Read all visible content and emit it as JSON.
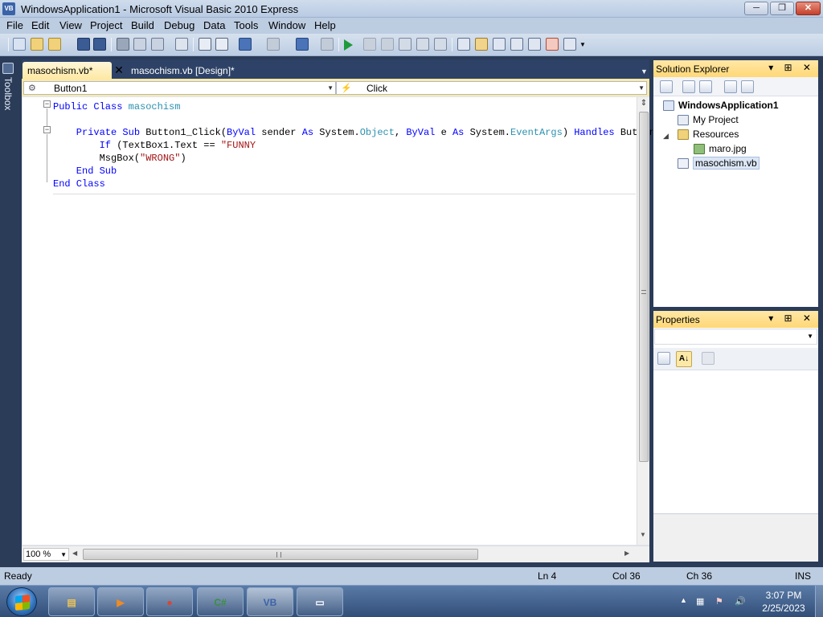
{
  "window": {
    "title": "WindowsApplication1 - Microsoft Visual Basic 2010 Express",
    "app_icon_text": "VB",
    "minimize_glyph": "─",
    "maximize_glyph": "❐",
    "close_glyph": "✕"
  },
  "menu": [
    "File",
    "Edit",
    "View",
    "Project",
    "Build",
    "Debug",
    "Data",
    "Tools",
    "Window",
    "Help"
  ],
  "toolbox_label": "Toolbox",
  "tabs": {
    "active_label": "masochism.vb*",
    "close_glyph": "✕",
    "design_label": "masochism.vb [Design]*",
    "dropdown_glyph": "▼"
  },
  "nav": {
    "object_glyph": "⚙",
    "object_value": "Button1",
    "event_glyph": "⚡",
    "event_value": "Click",
    "arrow": "▼"
  },
  "code": {
    "lines": [
      [
        {
          "t": "Public Class ",
          "c": "kw"
        },
        {
          "t": "masochism",
          "c": "ty"
        }
      ],
      [],
      [
        {
          "t": "    Private Sub ",
          "c": "kw"
        },
        {
          "t": "Button1_Click(",
          "c": ""
        },
        {
          "t": "ByVal ",
          "c": "kw"
        },
        {
          "t": "sender ",
          "c": ""
        },
        {
          "t": "As ",
          "c": "kw"
        },
        {
          "t": "System.",
          "c": ""
        },
        {
          "t": "Object",
          "c": "ty"
        },
        {
          "t": ", ",
          "c": ""
        },
        {
          "t": "ByVal ",
          "c": "kw"
        },
        {
          "t": "e ",
          "c": ""
        },
        {
          "t": "As ",
          "c": "kw"
        },
        {
          "t": "System.",
          "c": ""
        },
        {
          "t": "EventArgs",
          "c": "ty"
        },
        {
          "t": ") ",
          "c": ""
        },
        {
          "t": "Handles ",
          "c": "kw"
        },
        {
          "t": "Button",
          "c": ""
        }
      ],
      [
        {
          "t": "        If ",
          "c": "kw"
        },
        {
          "t": "(TextBox1.Text == ",
          "c": ""
        },
        {
          "t": "\"FUNNY",
          "c": "st"
        }
      ],
      [
        {
          "t": "        MsgBox(",
          "c": ""
        },
        {
          "t": "\"WRONG\"",
          "c": "st"
        },
        {
          "t": ")",
          "c": ""
        }
      ],
      [
        {
          "t": "    End Sub",
          "c": "kw"
        }
      ],
      [
        {
          "t": "End Class",
          "c": "kw"
        }
      ]
    ]
  },
  "editor": {
    "zoom": "100 %",
    "zoom_arrow": "▼",
    "split_glyph": "⇕",
    "left_arrow": "◀",
    "right_arrow": "▶",
    "down_arrow": "▼",
    "fold_minus": "−"
  },
  "solution_explorer": {
    "title": "Solution Explorer",
    "header_buttons": "▾ ⊞ ✕",
    "items": [
      {
        "label": "WindowsApplication1",
        "bold": true
      },
      {
        "label": "My Project"
      },
      {
        "label": "Resources",
        "expander": "◢"
      },
      {
        "label": "maro.jpg"
      },
      {
        "label": "masochism.vb",
        "selected": true
      }
    ]
  },
  "properties": {
    "title": "Properties",
    "header_buttons": "▾ ⊞ ✕",
    "combo_arrow": "▼",
    "sort_glyph": "A↓"
  },
  "status": {
    "ready": "Ready",
    "ln": "Ln 4",
    "col": "Col 36",
    "ch": "Ch 36",
    "mode": "INS"
  },
  "taskbar": {
    "apps": [
      {
        "name": "explorer",
        "glyph": "▤",
        "color": "#e7c25a"
      },
      {
        "name": "media-player",
        "glyph": "▶",
        "color": "#f08a24"
      },
      {
        "name": "chrome",
        "glyph": "●",
        "color": "#db4437"
      },
      {
        "name": "csharp",
        "glyph": "C#",
        "color": "#3c8f3c"
      },
      {
        "name": "visual-basic",
        "glyph": "VB",
        "color": "#3b63a8"
      },
      {
        "name": "window",
        "glyph": "▭",
        "color": "#ffffff"
      }
    ],
    "time": "3:07 PM",
    "date": "2/25/2023",
    "tray": {
      "up": "▲",
      "network": "▦",
      "flag": "⚑",
      "volume": "🔊"
    }
  }
}
